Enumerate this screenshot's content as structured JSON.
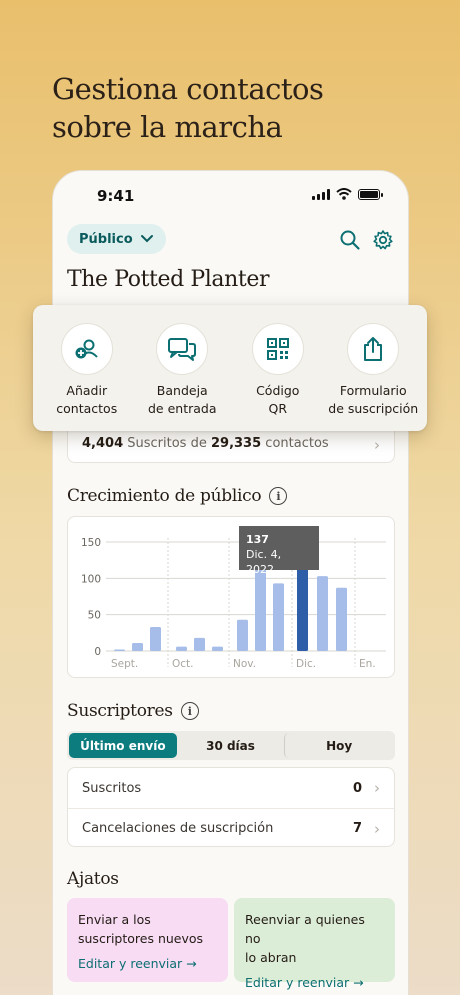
{
  "headline": {
    "line1": "Gestiona contactos",
    "line2": "sobre la marcha"
  },
  "status_bar": {
    "time": "9:41"
  },
  "header": {
    "audience_label": "Público",
    "title": "The Potted Planter"
  },
  "quick_actions": [
    {
      "line1": "Añadir",
      "line2": "contactos",
      "icon": "add-contact-icon"
    },
    {
      "line1": "Bandeja",
      "line2": "de entrada",
      "icon": "inbox-chat-icon"
    },
    {
      "line1": "Código",
      "line2": "QR",
      "icon": "qr-code-icon"
    },
    {
      "line1": "Formulario",
      "line2": "de suscripción",
      "icon": "share-form-icon"
    }
  ],
  "contacts_summary": {
    "subscribed": "4,404",
    "middle": "Suscritos de",
    "total": "29,335",
    "suffix": "contactos"
  },
  "growth": {
    "title": "Crecimiento de público",
    "tooltip": {
      "value": "137",
      "date": "Dic. 4, 2022"
    }
  },
  "chart_data": {
    "type": "bar",
    "title": "Crecimiento de público",
    "ylim": [
      0,
      150
    ],
    "yticks": [
      0,
      50,
      100,
      150
    ],
    "xticks": [
      "Sept.",
      "Oct.",
      "Nov.",
      "Dic.",
      "En."
    ],
    "grid": true,
    "values": [
      2,
      11,
      33,
      6,
      18,
      6,
      43,
      113,
      93,
      137,
      103,
      87
    ],
    "highlight_index": 9,
    "bar_color": "#a5bde8",
    "highlight_color": "#2f5ea8"
  },
  "subscribers": {
    "title": "Suscriptores",
    "tabs": [
      "Último envío",
      "30 días",
      "Hoy"
    ],
    "rows": [
      {
        "label": "Suscritos",
        "value": "0"
      },
      {
        "label": "Cancelaciones de suscripción",
        "value": "7"
      }
    ]
  },
  "tips": {
    "title": "Ajatos",
    "cards": [
      {
        "line1": "Enviar a los",
        "line2": "suscriptores nuevos",
        "link": "Editar y reenviar →",
        "color": "#f7dcf4"
      },
      {
        "line1": "Reenviar a quienes no",
        "line2": "lo abran",
        "link": "Editar y reenviar →",
        "color": "#dcedd7"
      }
    ]
  },
  "colors": {
    "accent": "#0c7c7f",
    "pill_bg": "#dff0ef"
  }
}
